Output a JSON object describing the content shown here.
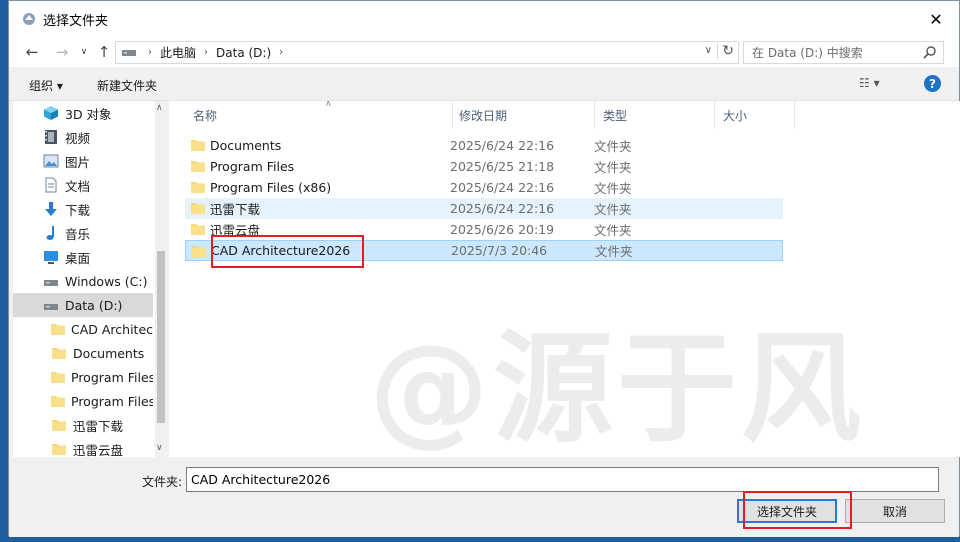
{
  "window": {
    "title": "选择文件夹",
    "close_glyph": "✕"
  },
  "address": {
    "crumbs": [
      "此电脑",
      "Data (D:)"
    ],
    "search_placeholder": "在 Data (D:) 中搜索"
  },
  "toolbar": {
    "organize": "组织 ▾",
    "new_folder": "新建文件夹",
    "view_glyph": "☷ ▾",
    "help": "?"
  },
  "nav_items": [
    {
      "label": "3D 对象",
      "icon": "cube-icon",
      "indent": 1
    },
    {
      "label": "视频",
      "icon": "video-icon",
      "indent": 1
    },
    {
      "label": "图片",
      "icon": "picture-icon",
      "indent": 1
    },
    {
      "label": "文档",
      "icon": "document-icon",
      "indent": 1
    },
    {
      "label": "下载",
      "icon": "download-icon",
      "indent": 1
    },
    {
      "label": "音乐",
      "icon": "music-icon",
      "indent": 1
    },
    {
      "label": "桌面",
      "icon": "desktop-icon",
      "indent": 1
    },
    {
      "label": "Windows (C:)",
      "icon": "drive-icon",
      "indent": 1
    },
    {
      "label": "Data (D:)",
      "icon": "drive-icon",
      "indent": 1,
      "selected": true
    },
    {
      "label": "CAD Architect",
      "icon": "folder-icon",
      "indent": 2
    },
    {
      "label": "Documents",
      "icon": "folder-icon",
      "indent": 2
    },
    {
      "label": "Program Files",
      "icon": "folder-icon",
      "indent": 2
    },
    {
      "label": "Program Files",
      "icon": "folder-icon",
      "indent": 2
    },
    {
      "label": "迅雷下载",
      "icon": "folder-icon",
      "indent": 2
    },
    {
      "label": "迅雷云盘",
      "icon": "folder-icon",
      "indent": 2
    }
  ],
  "columns": {
    "name": "名称",
    "date": "修改日期",
    "type": "类型",
    "size": "大小"
  },
  "files": [
    {
      "name": "Documents",
      "date": "2025/6/24 22:16",
      "type": "文件夹",
      "state": ""
    },
    {
      "name": "Program Files",
      "date": "2025/6/25 21:18",
      "type": "文件夹",
      "state": ""
    },
    {
      "name": "Program Files (x86)",
      "date": "2025/6/24 22:16",
      "type": "文件夹",
      "state": ""
    },
    {
      "name": "迅雷下载",
      "date": "2025/6/24 22:16",
      "type": "文件夹",
      "state": "hover"
    },
    {
      "name": "迅雷云盘",
      "date": "2025/6/26 20:19",
      "type": "文件夹",
      "state": ""
    },
    {
      "name": "CAD Architecture2026",
      "date": "2025/7/3 20:46",
      "type": "文件夹",
      "state": "selected"
    }
  ],
  "watermark": "@源于风",
  "bottom": {
    "folder_label": "文件夹:",
    "folder_value": "CAD Architecture2026",
    "select_button": "选择文件夹",
    "cancel_button": "取消"
  },
  "colors": {
    "accent": "#1e73c7",
    "selection": "#cce8ff",
    "highlight_box": "#e02020",
    "folder": "#f8d775"
  }
}
